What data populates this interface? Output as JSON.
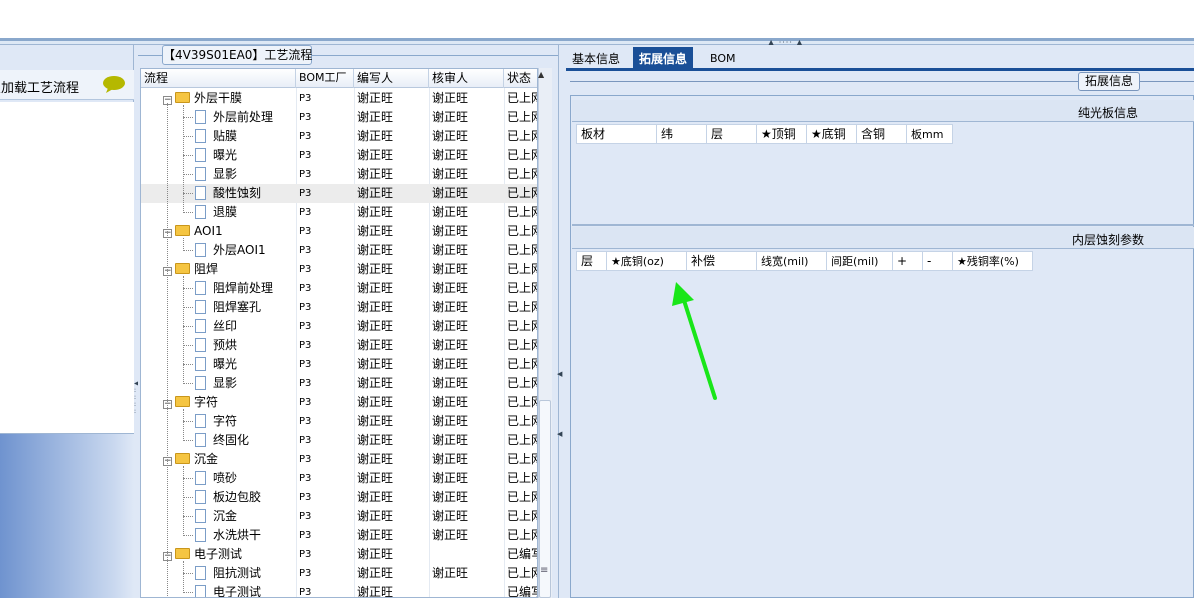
{
  "colors": {
    "accent": "#1a4f97",
    "panel": "#dfe8f6",
    "annotation_arrow": "#19e619"
  },
  "left_panel": {
    "header_text": "点加载工艺流程",
    "chat_icon": "speech-bubble-icon"
  },
  "middle_panel": {
    "title": "【4V39S01EA0】工艺流程",
    "columns": [
      "流程",
      "BOM工厂",
      "编写人",
      "核审人",
      "状态"
    ],
    "rows": [
      {
        "name": "外层干膜",
        "level": 0,
        "type": "folder",
        "bom": "P3",
        "writer": "谢正旺",
        "reviewer": "谢正旺",
        "status": "已上网"
      },
      {
        "name": "外层前处理",
        "level": 1,
        "type": "doc",
        "bom": "P3",
        "writer": "谢正旺",
        "reviewer": "谢正旺",
        "status": "已上网"
      },
      {
        "name": "贴膜",
        "level": 1,
        "type": "doc",
        "bom": "P3",
        "writer": "谢正旺",
        "reviewer": "谢正旺",
        "status": "已上网"
      },
      {
        "name": "曝光",
        "level": 1,
        "type": "doc",
        "bom": "P3",
        "writer": "谢正旺",
        "reviewer": "谢正旺",
        "status": "已上网"
      },
      {
        "name": "显影",
        "level": 1,
        "type": "doc",
        "bom": "P3",
        "writer": "谢正旺",
        "reviewer": "谢正旺",
        "status": "已上网"
      },
      {
        "name": "酸性蚀刻",
        "level": 1,
        "type": "doc",
        "bom": "P3",
        "writer": "谢正旺",
        "reviewer": "谢正旺",
        "status": "已上网",
        "selected": true
      },
      {
        "name": "退膜",
        "level": 1,
        "type": "doc",
        "bom": "P3",
        "writer": "谢正旺",
        "reviewer": "谢正旺",
        "status": "已上网"
      },
      {
        "name": "AOI1",
        "level": 0,
        "type": "folder",
        "bom": "P3",
        "writer": "谢正旺",
        "reviewer": "谢正旺",
        "status": "已上网"
      },
      {
        "name": "外层AOI1",
        "level": 1,
        "type": "doc",
        "bom": "P3",
        "writer": "谢正旺",
        "reviewer": "谢正旺",
        "status": "已上网"
      },
      {
        "name": "阻焊",
        "level": 0,
        "type": "folder",
        "bom": "P3",
        "writer": "谢正旺",
        "reviewer": "谢正旺",
        "status": "已上网"
      },
      {
        "name": "阻焊前处理",
        "level": 1,
        "type": "doc",
        "bom": "P3",
        "writer": "谢正旺",
        "reviewer": "谢正旺",
        "status": "已上网"
      },
      {
        "name": "阻焊塞孔",
        "level": 1,
        "type": "doc",
        "bom": "P3",
        "writer": "谢正旺",
        "reviewer": "谢正旺",
        "status": "已上网"
      },
      {
        "name": "丝印",
        "level": 1,
        "type": "doc",
        "bom": "P3",
        "writer": "谢正旺",
        "reviewer": "谢正旺",
        "status": "已上网"
      },
      {
        "name": "预烘",
        "level": 1,
        "type": "doc",
        "bom": "P3",
        "writer": "谢正旺",
        "reviewer": "谢正旺",
        "status": "已上网"
      },
      {
        "name": "曝光",
        "level": 1,
        "type": "doc",
        "bom": "P3",
        "writer": "谢正旺",
        "reviewer": "谢正旺",
        "status": "已上网"
      },
      {
        "name": "显影",
        "level": 1,
        "type": "doc",
        "bom": "P3",
        "writer": "谢正旺",
        "reviewer": "谢正旺",
        "status": "已上网"
      },
      {
        "name": "字符",
        "level": 0,
        "type": "folder",
        "bom": "P3",
        "writer": "谢正旺",
        "reviewer": "谢正旺",
        "status": "已上网"
      },
      {
        "name": "字符",
        "level": 1,
        "type": "doc",
        "bom": "P3",
        "writer": "谢正旺",
        "reviewer": "谢正旺",
        "status": "已上网"
      },
      {
        "name": "终固化",
        "level": 1,
        "type": "doc",
        "bom": "P3",
        "writer": "谢正旺",
        "reviewer": "谢正旺",
        "status": "已上网"
      },
      {
        "name": "沉金",
        "level": 0,
        "type": "folder",
        "bom": "P3",
        "writer": "谢正旺",
        "reviewer": "谢正旺",
        "status": "已上网"
      },
      {
        "name": "喷砂",
        "level": 1,
        "type": "doc",
        "bom": "P3",
        "writer": "谢正旺",
        "reviewer": "谢正旺",
        "status": "已上网"
      },
      {
        "name": "板边包胶",
        "level": 1,
        "type": "doc",
        "bom": "P3",
        "writer": "谢正旺",
        "reviewer": "谢正旺",
        "status": "已上网"
      },
      {
        "name": "沉金",
        "level": 1,
        "type": "doc",
        "bom": "P3",
        "writer": "谢正旺",
        "reviewer": "谢正旺",
        "status": "已上网"
      },
      {
        "name": "水洗烘干",
        "level": 1,
        "type": "doc",
        "bom": "P3",
        "writer": "谢正旺",
        "reviewer": "谢正旺",
        "status": "已上网"
      },
      {
        "name": "电子测试",
        "level": 0,
        "type": "folder",
        "bom": "P3",
        "writer": "谢正旺",
        "reviewer": "",
        "status": "已编写"
      },
      {
        "name": "阻抗测试",
        "level": 1,
        "type": "doc",
        "bom": "P3",
        "writer": "谢正旺",
        "reviewer": "谢正旺",
        "status": "已上网"
      },
      {
        "name": "电子测试",
        "level": 1,
        "type": "doc",
        "bom": "P3",
        "writer": "谢正旺",
        "reviewer": "",
        "status": "已编写"
      }
    ]
  },
  "right_panel": {
    "tabs": [
      {
        "label": "基本信息",
        "active": false
      },
      {
        "label": "拓展信息",
        "active": true
      },
      {
        "label": "BOM",
        "active": false
      }
    ],
    "fieldset_title": "拓展信息",
    "section1": {
      "title": "纯光板信息",
      "columns": [
        "板材",
        "纬",
        "层",
        "★顶铜",
        "★底铜",
        "含铜",
        "板mm"
      ]
    },
    "section2": {
      "title": "内层蚀刻参数",
      "columns": [
        "层",
        "★底铜(oz)",
        "补偿",
        "线宽(mil)",
        "间距(mil)",
        "+",
        "-",
        "★残铜率(%)"
      ]
    }
  }
}
